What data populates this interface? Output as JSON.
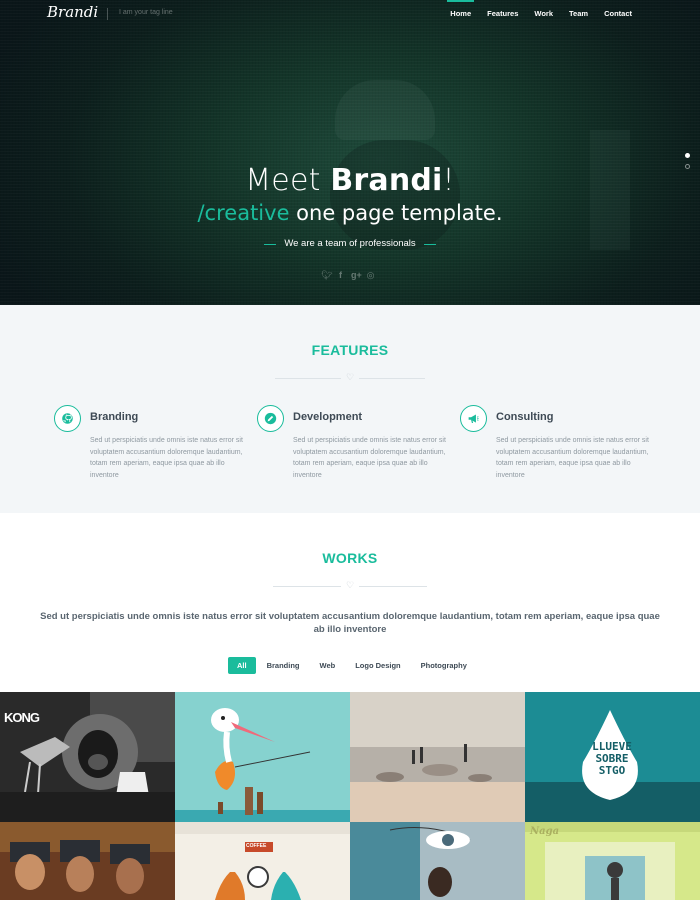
{
  "nav": {
    "logo": "Brandi",
    "tagline": "I am your tag line",
    "menu": [
      "Home",
      "Features",
      "Work",
      "Team",
      "Contact"
    ]
  },
  "hero": {
    "title_light": "Meet ",
    "title_bold": "Brandi",
    "title_end": "!",
    "subtitle_accent": "/creative",
    "subtitle_rest": " one page template.",
    "tagline": "We are a team of professionals",
    "social_icons": [
      "twitter-icon",
      "facebook-icon",
      "google-plus-icon",
      "dribbble-icon"
    ]
  },
  "features": {
    "title": "FEATURES",
    "items": [
      {
        "icon": "github-icon",
        "title": "Branding",
        "text": "Sed ut perspiciatis unde omnis iste natus error sit voluptatem accusantium doloremque laudantium, totam rem aperiam, eaque ipsa quae ab illo inventore"
      },
      {
        "icon": "pencil-icon",
        "title": "Development",
        "text": "Sed ut perspiciatis unde omnis iste natus error sit voluptatem accusantium doloremque laudantium, totam rem aperiam, eaque ipsa quae ab illo inventore"
      },
      {
        "icon": "megaphone-icon",
        "title": "Consulting",
        "text": "Sed ut perspiciatis unde omnis iste natus error sit voluptatem accusantium doloremque laudantium, totam rem aperiam, eaque ipsa quae ab illo inventore"
      }
    ]
  },
  "works": {
    "title": "WORKS",
    "text": "Sed ut perspiciatis unde omnis iste natus error sit voluptatem accusantium doloremque laudantium, totam rem aperiam, eaque ipsa quae ab illo inventore",
    "filters": [
      "All",
      "Branding",
      "Web",
      "Logo Design",
      "Photography"
    ],
    "active_filter": "All",
    "tile_texts": {
      "kong": "KONG",
      "drop_line1": "LLUEVE",
      "drop_line2": "SOBRE",
      "drop_line3": "STGO",
      "coffee": "COFFEE",
      "naga": "Naga"
    }
  },
  "colors": {
    "accent": "#1abc9c",
    "hero_bg": "#0f2a24",
    "features_bg": "#f3f6f8"
  }
}
